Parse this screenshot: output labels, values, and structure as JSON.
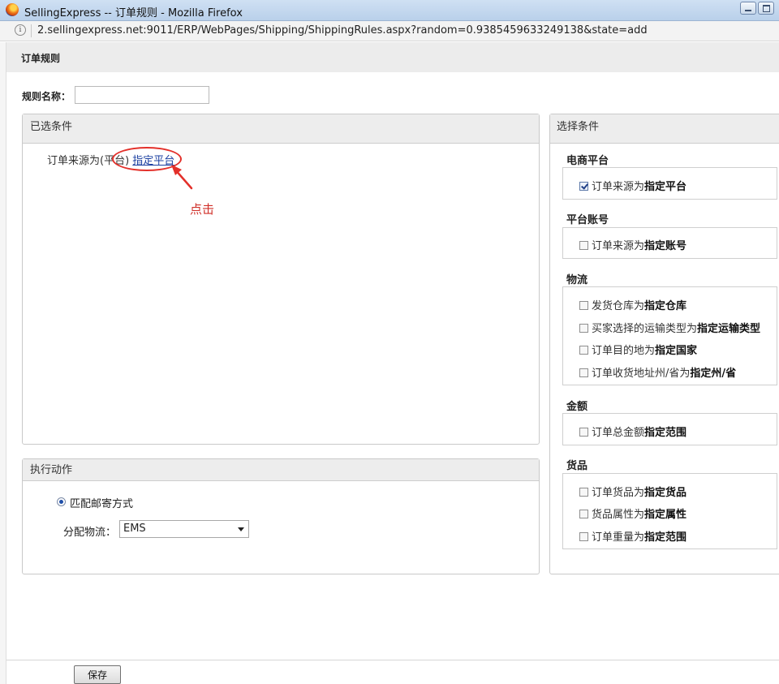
{
  "window": {
    "title": "SellingExpress -- 订单规则 - Mozilla Firefox",
    "url": "2.sellingexpress.net:9011/ERP/WebPages/Shipping/ShippingRules.aspx?random=0.9385459633249138&state=add"
  },
  "page": {
    "header_title": "订单规则"
  },
  "rule_name": {
    "label": "规则名称：",
    "value": ""
  },
  "selected_conditions": {
    "title": "已选条件",
    "condition_prefix": "订单来源为(平台)",
    "condition_link": "指定平台"
  },
  "annotation": {
    "note": "点击"
  },
  "action": {
    "title": "执行动作",
    "radio_label": "匹配邮寄方式",
    "dist_label": "分配物流：",
    "dist_value": "EMS"
  },
  "choose": {
    "title": "选择条件",
    "sections": [
      {
        "title": "电商平台",
        "options": [
          {
            "text": "订单来源为",
            "bold": "指定平台",
            "checked": true
          }
        ]
      },
      {
        "title": "平台账号",
        "options": [
          {
            "text": "订单来源为",
            "bold": "指定账号",
            "checked": false
          }
        ]
      },
      {
        "title": "物流",
        "options": [
          {
            "text": "发货仓库为",
            "bold": "指定仓库",
            "checked": false
          },
          {
            "text": "买家选择的运输类型为",
            "bold": "指定运输类型",
            "checked": false
          },
          {
            "text": "订单目的地为",
            "bold": "指定国家",
            "checked": false
          },
          {
            "text": "订单收货地址州/省为",
            "bold": "指定州/省",
            "checked": false
          }
        ]
      },
      {
        "title": "金额",
        "options": [
          {
            "text": "订单总金额",
            "bold": "指定范围",
            "checked": false
          }
        ]
      },
      {
        "title": "货品",
        "options": [
          {
            "text": "订单货品为",
            "bold": "指定货品",
            "checked": false
          },
          {
            "text": "货品属性为",
            "bold": "指定属性",
            "checked": false
          },
          {
            "text": "订单重量为",
            "bold": "指定范围",
            "checked": false
          }
        ]
      }
    ]
  },
  "footer": {
    "save_label": "保存"
  },
  "colors": {
    "annotation_red": "#e3302a",
    "link_blue": "#1a3fa0"
  },
  "icons": {
    "browser": "firefox-icon",
    "site_info": "info-icon",
    "dropdown": "chevron-down-icon"
  }
}
